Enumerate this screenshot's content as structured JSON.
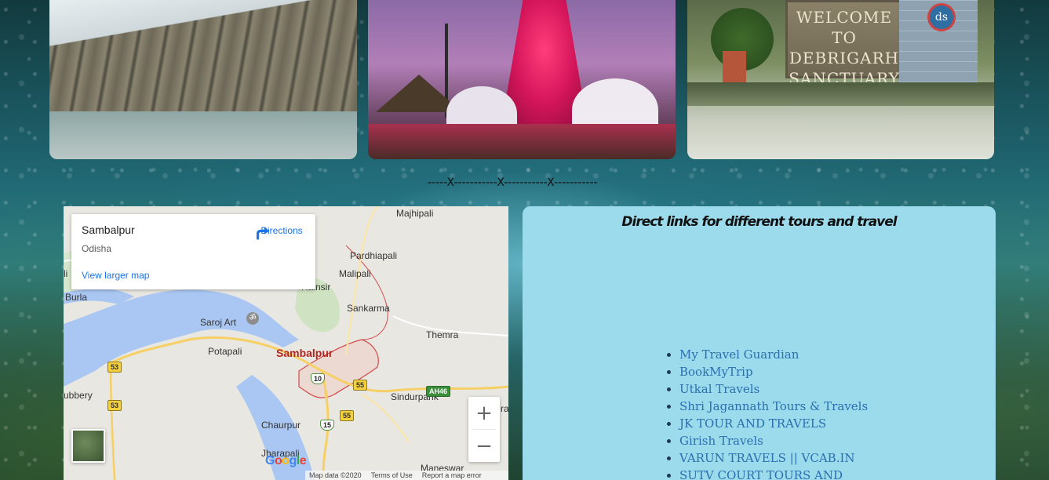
{
  "divider": {
    "text": "-----X-----------X-----------X-----------"
  },
  "photos": {
    "sanctuary_sign": [
      "WELCOME TO",
      "DEBRIGARH",
      "SANCTUARY"
    ],
    "logo": "ds"
  },
  "map": {
    "info": {
      "title": "Sambalpur",
      "subtitle": "Odisha",
      "larger_map": "View larger map",
      "directions": "Directions"
    },
    "labels": {
      "majhipali": "Majhipali",
      "pardhiapali": "Pardhiapali",
      "malipali": "Malipali",
      "burla": "Burla",
      "rengali": "Rainsir",
      "sankarma": "Sankarma",
      "saroj_art": "Saroj Art",
      "themra": "Themra",
      "potapali": "Potapali",
      "sambalpur": "Sambalpur",
      "sindurpank": "Sindurpank",
      "chaurpur": "Chaurpur",
      "jharapali": "Jharapali",
      "maneswar": "Maneswar",
      "bubbery": "ubbery",
      "li": "li",
      "ra": "ra"
    },
    "shields": {
      "r53a": "53",
      "r53b": "53",
      "r10": "10",
      "r55a": "55",
      "r55b": "55",
      "r15": "15",
      "ah46": "AH46"
    },
    "zoom_in": "+",
    "zoom_out": "−",
    "google": [
      "G",
      "o",
      "o",
      "g",
      "l",
      "e"
    ],
    "footer": [
      "Map data ©2020",
      "Terms of Use",
      "Report a map error"
    ]
  },
  "links_panel": {
    "title": "Direct links for different tours and travel",
    "links": [
      "My Travel Guardian",
      "BookMyTrip",
      "Utkal Travels",
      "Shri Jagannath Tours & Travels",
      "JK TOUR AND TRAVELS",
      "Girish Travels",
      "VARUN TRAVELS || VCAB.IN",
      "SUTV COURT TOURS AND"
    ]
  },
  "colors": {
    "panel_bg": "#9bdbec",
    "link": "#2a6fb0",
    "map_city": "#b3261e",
    "google_blue": "#4285f4",
    "google_red": "#ea4335",
    "google_yellow": "#fbbc05",
    "google_green": "#34a853"
  }
}
